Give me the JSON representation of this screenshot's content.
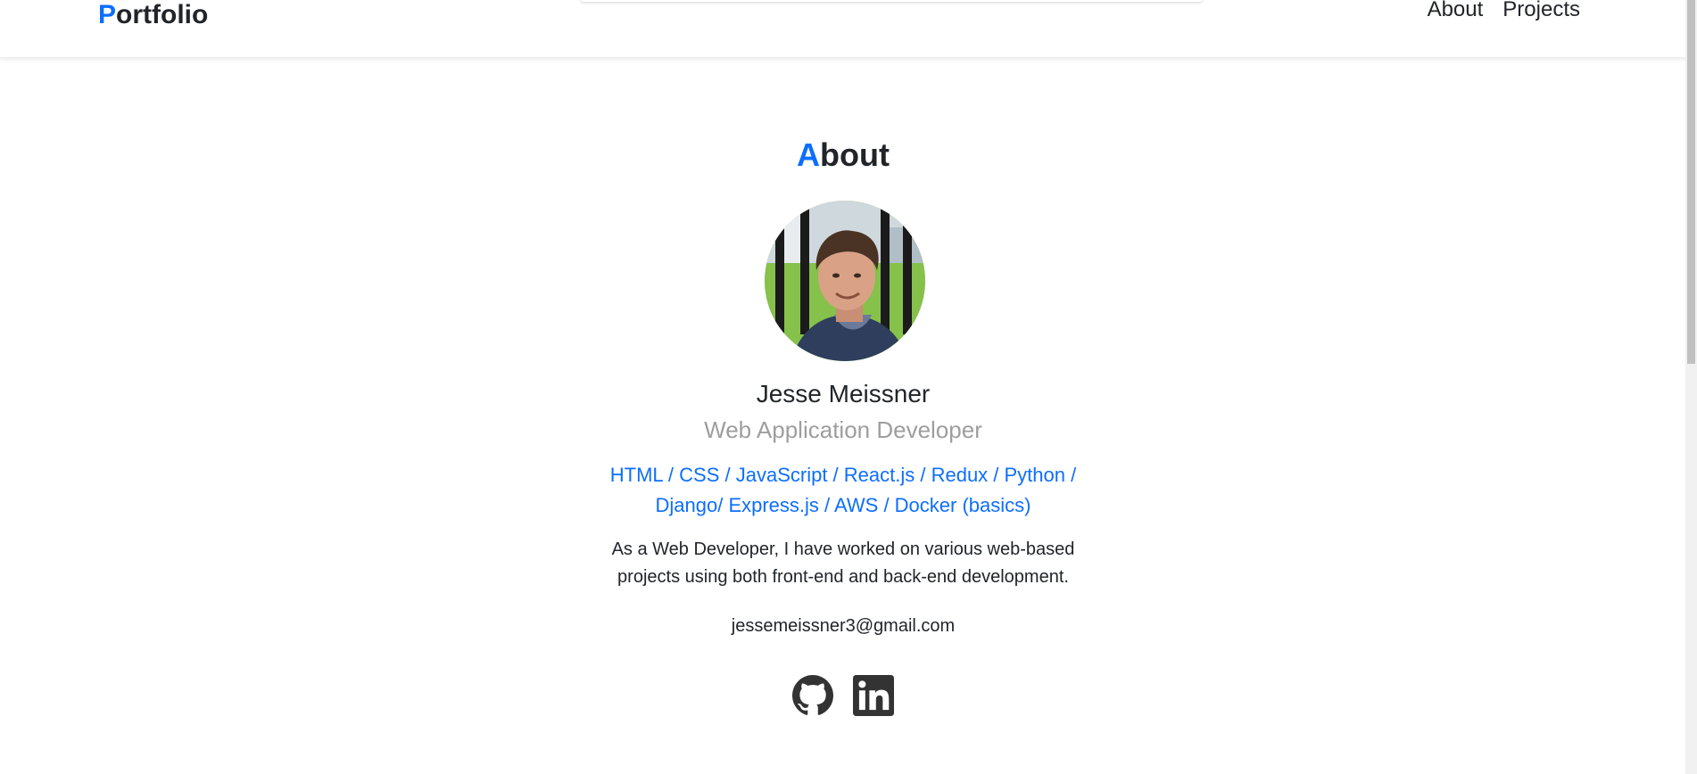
{
  "header": {
    "brand_first": "P",
    "brand_rest": "ortfolio",
    "nav": [
      {
        "label": "About"
      },
      {
        "label": "Projects"
      }
    ]
  },
  "about": {
    "title_first": "A",
    "title_rest": "bout",
    "name": "Jesse Meissner",
    "role": "Web Application Developer",
    "skills": "HTML / CSS / JavaScript / React.js / Redux / Python / Django/ Express.js / AWS / Docker (basics)",
    "bio": "As a Web Developer, I have worked on various web-based projects using both front-end and back-end development.",
    "email": "jessemeissner3@gmail.com",
    "social_icons": [
      "github-icon",
      "linkedin-icon"
    ]
  },
  "colors": {
    "accent": "#0d6efd",
    "text": "#212529",
    "muted": "#9e9e9e",
    "icon": "#333333"
  }
}
